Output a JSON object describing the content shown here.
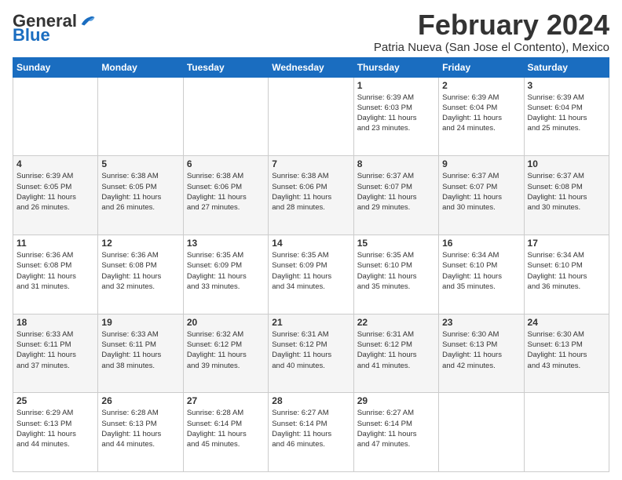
{
  "header": {
    "logo_general": "General",
    "logo_blue": "Blue",
    "month": "February 2024",
    "location": "Patria Nueva (San Jose el Contento), Mexico"
  },
  "weekdays": [
    "Sunday",
    "Monday",
    "Tuesday",
    "Wednesday",
    "Thursday",
    "Friday",
    "Saturday"
  ],
  "weeks": [
    [
      {
        "day": "",
        "info": ""
      },
      {
        "day": "",
        "info": ""
      },
      {
        "day": "",
        "info": ""
      },
      {
        "day": "",
        "info": ""
      },
      {
        "day": "1",
        "info": "Sunrise: 6:39 AM\nSunset: 6:03 PM\nDaylight: 11 hours\nand 23 minutes."
      },
      {
        "day": "2",
        "info": "Sunrise: 6:39 AM\nSunset: 6:04 PM\nDaylight: 11 hours\nand 24 minutes."
      },
      {
        "day": "3",
        "info": "Sunrise: 6:39 AM\nSunset: 6:04 PM\nDaylight: 11 hours\nand 25 minutes."
      }
    ],
    [
      {
        "day": "4",
        "info": "Sunrise: 6:39 AM\nSunset: 6:05 PM\nDaylight: 11 hours\nand 26 minutes."
      },
      {
        "day": "5",
        "info": "Sunrise: 6:38 AM\nSunset: 6:05 PM\nDaylight: 11 hours\nand 26 minutes."
      },
      {
        "day": "6",
        "info": "Sunrise: 6:38 AM\nSunset: 6:06 PM\nDaylight: 11 hours\nand 27 minutes."
      },
      {
        "day": "7",
        "info": "Sunrise: 6:38 AM\nSunset: 6:06 PM\nDaylight: 11 hours\nand 28 minutes."
      },
      {
        "day": "8",
        "info": "Sunrise: 6:37 AM\nSunset: 6:07 PM\nDaylight: 11 hours\nand 29 minutes."
      },
      {
        "day": "9",
        "info": "Sunrise: 6:37 AM\nSunset: 6:07 PM\nDaylight: 11 hours\nand 30 minutes."
      },
      {
        "day": "10",
        "info": "Sunrise: 6:37 AM\nSunset: 6:08 PM\nDaylight: 11 hours\nand 30 minutes."
      }
    ],
    [
      {
        "day": "11",
        "info": "Sunrise: 6:36 AM\nSunset: 6:08 PM\nDaylight: 11 hours\nand 31 minutes."
      },
      {
        "day": "12",
        "info": "Sunrise: 6:36 AM\nSunset: 6:08 PM\nDaylight: 11 hours\nand 32 minutes."
      },
      {
        "day": "13",
        "info": "Sunrise: 6:35 AM\nSunset: 6:09 PM\nDaylight: 11 hours\nand 33 minutes."
      },
      {
        "day": "14",
        "info": "Sunrise: 6:35 AM\nSunset: 6:09 PM\nDaylight: 11 hours\nand 34 minutes."
      },
      {
        "day": "15",
        "info": "Sunrise: 6:35 AM\nSunset: 6:10 PM\nDaylight: 11 hours\nand 35 minutes."
      },
      {
        "day": "16",
        "info": "Sunrise: 6:34 AM\nSunset: 6:10 PM\nDaylight: 11 hours\nand 35 minutes."
      },
      {
        "day": "17",
        "info": "Sunrise: 6:34 AM\nSunset: 6:10 PM\nDaylight: 11 hours\nand 36 minutes."
      }
    ],
    [
      {
        "day": "18",
        "info": "Sunrise: 6:33 AM\nSunset: 6:11 PM\nDaylight: 11 hours\nand 37 minutes."
      },
      {
        "day": "19",
        "info": "Sunrise: 6:33 AM\nSunset: 6:11 PM\nDaylight: 11 hours\nand 38 minutes."
      },
      {
        "day": "20",
        "info": "Sunrise: 6:32 AM\nSunset: 6:12 PM\nDaylight: 11 hours\nand 39 minutes."
      },
      {
        "day": "21",
        "info": "Sunrise: 6:31 AM\nSunset: 6:12 PM\nDaylight: 11 hours\nand 40 minutes."
      },
      {
        "day": "22",
        "info": "Sunrise: 6:31 AM\nSunset: 6:12 PM\nDaylight: 11 hours\nand 41 minutes."
      },
      {
        "day": "23",
        "info": "Sunrise: 6:30 AM\nSunset: 6:13 PM\nDaylight: 11 hours\nand 42 minutes."
      },
      {
        "day": "24",
        "info": "Sunrise: 6:30 AM\nSunset: 6:13 PM\nDaylight: 11 hours\nand 43 minutes."
      }
    ],
    [
      {
        "day": "25",
        "info": "Sunrise: 6:29 AM\nSunset: 6:13 PM\nDaylight: 11 hours\nand 44 minutes."
      },
      {
        "day": "26",
        "info": "Sunrise: 6:28 AM\nSunset: 6:13 PM\nDaylight: 11 hours\nand 44 minutes."
      },
      {
        "day": "27",
        "info": "Sunrise: 6:28 AM\nSunset: 6:14 PM\nDaylight: 11 hours\nand 45 minutes."
      },
      {
        "day": "28",
        "info": "Sunrise: 6:27 AM\nSunset: 6:14 PM\nDaylight: 11 hours\nand 46 minutes."
      },
      {
        "day": "29",
        "info": "Sunrise: 6:27 AM\nSunset: 6:14 PM\nDaylight: 11 hours\nand 47 minutes."
      },
      {
        "day": "",
        "info": ""
      },
      {
        "day": "",
        "info": ""
      }
    ]
  ]
}
